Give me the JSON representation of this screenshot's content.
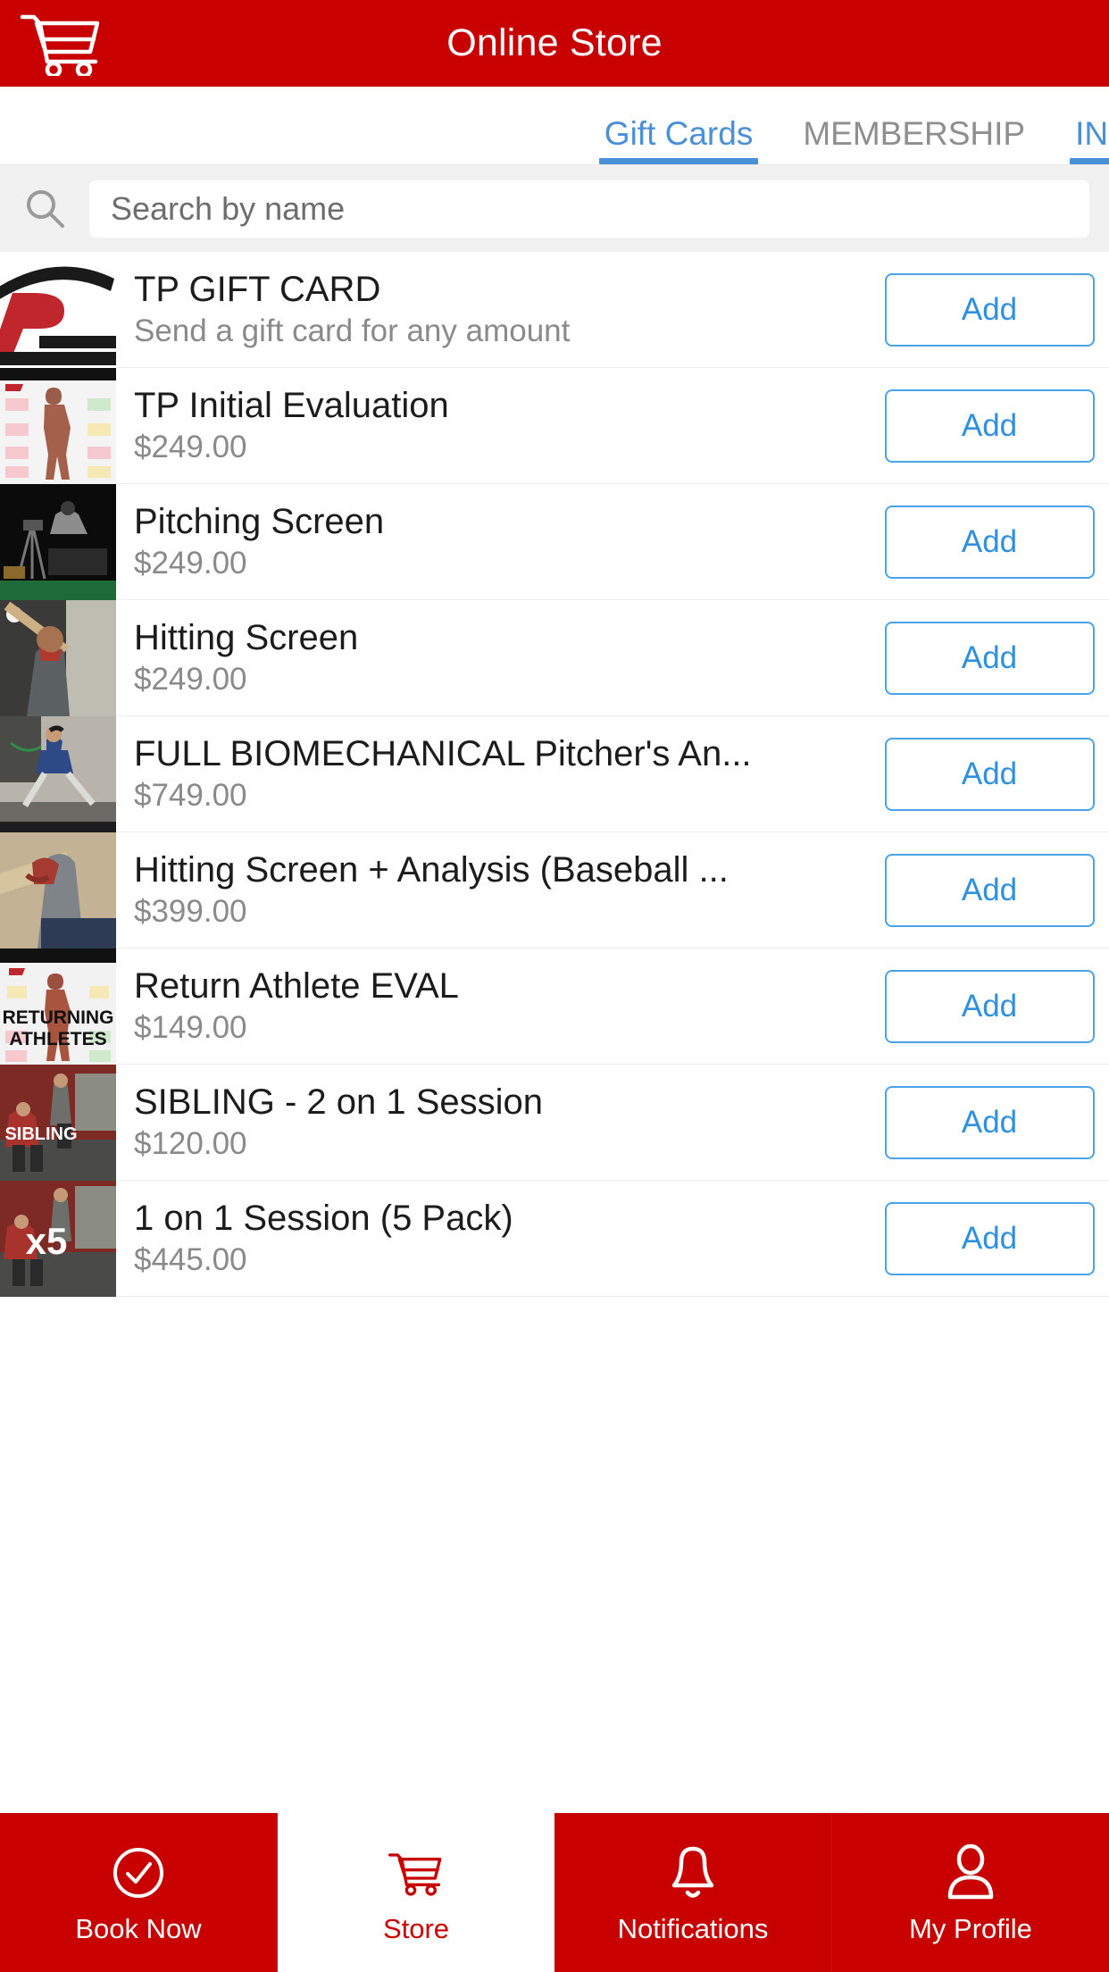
{
  "header": {
    "title": "Online Store",
    "cart_icon": "shopping-cart-icon"
  },
  "tabs": [
    {
      "label": "Gift Cards",
      "active": true
    },
    {
      "label": "MEMBERSHIP",
      "active": false
    },
    {
      "label": "INIT",
      "active": true,
      "truncated": true
    }
  ],
  "search": {
    "icon": "search-icon",
    "placeholder": "Search by name",
    "value": ""
  },
  "products": [
    {
      "title": "TP GIFT CARD",
      "subtitle": "Send a gift card for any amount",
      "button": "Add",
      "thumb": "tinsley-performance-logo"
    },
    {
      "title": "TP Initial Evaluation",
      "subtitle": "$249.00",
      "button": "Add",
      "thumb": "anatomy-chart-photo"
    },
    {
      "title": "Pitching Screen",
      "subtitle": "$249.00",
      "button": "Add",
      "thumb": "pitcher-camera-photo"
    },
    {
      "title": "Hitting Screen",
      "subtitle": "$249.00",
      "button": "Add",
      "thumb": "batter-cage-photo"
    },
    {
      "title": "FULL BIOMECHANICAL Pitcher's An...",
      "subtitle": "$749.00",
      "button": "Add",
      "thumb": "motion-capture-suit-photo"
    },
    {
      "title": "Hitting Screen + Analysis (Baseball ...",
      "subtitle": "$399.00",
      "button": "Add",
      "thumb": "bat-swing-closeup-photo"
    },
    {
      "title": "Return Athlete EVAL",
      "subtitle": "$149.00",
      "button": "Add",
      "thumb": "returning-athletes-graphic"
    },
    {
      "title": "SIBLING - 2 on 1 Session",
      "subtitle": "$120.00",
      "button": "Add",
      "thumb": "sibling-training-photo"
    },
    {
      "title": "1 on 1 Session (5 Pack)",
      "subtitle": "$445.00",
      "button": "Add",
      "thumb": "x5-training-photo"
    }
  ],
  "bottom_nav": [
    {
      "label": "Book Now",
      "icon": "check-circle-icon",
      "active": false
    },
    {
      "label": "Store",
      "icon": "shopping-cart-icon",
      "active": true
    },
    {
      "label": "Notifications",
      "icon": "bell-icon",
      "active": false
    },
    {
      "label": "My Profile",
      "icon": "person-icon",
      "active": false
    }
  ],
  "colors": {
    "brand_red": "#c80000",
    "accent_blue": "#4a90d9",
    "button_blue": "#2f8fe0",
    "search_bg": "#f1f1f1"
  }
}
